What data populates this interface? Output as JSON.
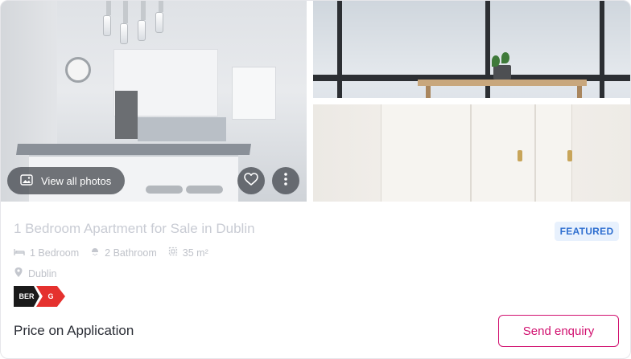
{
  "gallery": {
    "view_all_label": "View all photos",
    "view_all_icon": "image-icon",
    "favorite_icon": "heart-icon",
    "more_icon": "more-vertical-icon"
  },
  "listing": {
    "title": "1 Bedroom Apartment for Sale in Dublin",
    "badge": "FEATURED",
    "features": [
      {
        "icon": "bed-icon",
        "label": "1 Bedroom"
      },
      {
        "icon": "shower-icon",
        "label": "2 Bathroom"
      },
      {
        "icon": "area-icon",
        "label": "35 m²"
      }
    ],
    "location": {
      "icon": "map-pin-icon",
      "label": "Dublin"
    },
    "ber": {
      "label": "BER",
      "rating": "G"
    },
    "price": "Price on Application",
    "cta_label": "Send enquiry"
  },
  "colors": {
    "accent": "#d1106f",
    "badge_bg": "#e8f1fd",
    "badge_text": "#2f6fd0",
    "ber_rating": "#e5312e"
  }
}
